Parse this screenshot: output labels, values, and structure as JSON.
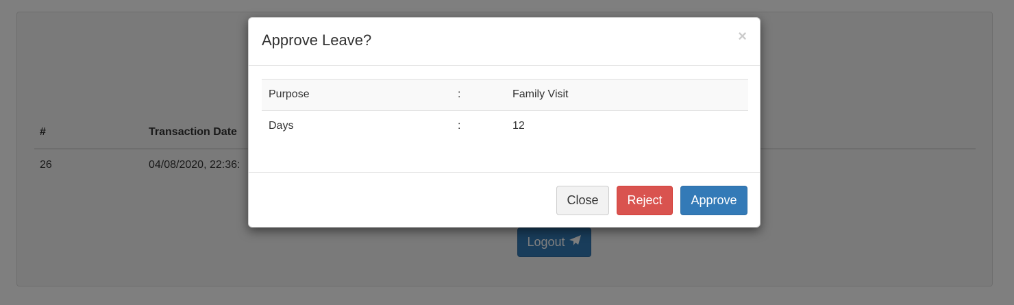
{
  "background": {
    "table": {
      "headers": [
        "#",
        "Transaction Date"
      ],
      "rows": [
        {
          "id": "26",
          "date": "04/08/2020, 22:36:"
        }
      ]
    },
    "logout_label": "Logout",
    "logout_icon": "send-icon"
  },
  "modal": {
    "title": "Approve Leave?",
    "close_symbol": "×",
    "rows": [
      {
        "label": "Purpose",
        "separator": ":",
        "value": "Family Visit"
      },
      {
        "label": "Days",
        "separator": ":",
        "value": "12"
      }
    ],
    "buttons": {
      "close": "Close",
      "reject": "Reject",
      "approve": "Approve"
    }
  },
  "colors": {
    "primary": "#337ab7",
    "danger": "#d9534f",
    "default": "#f2f2f2"
  }
}
